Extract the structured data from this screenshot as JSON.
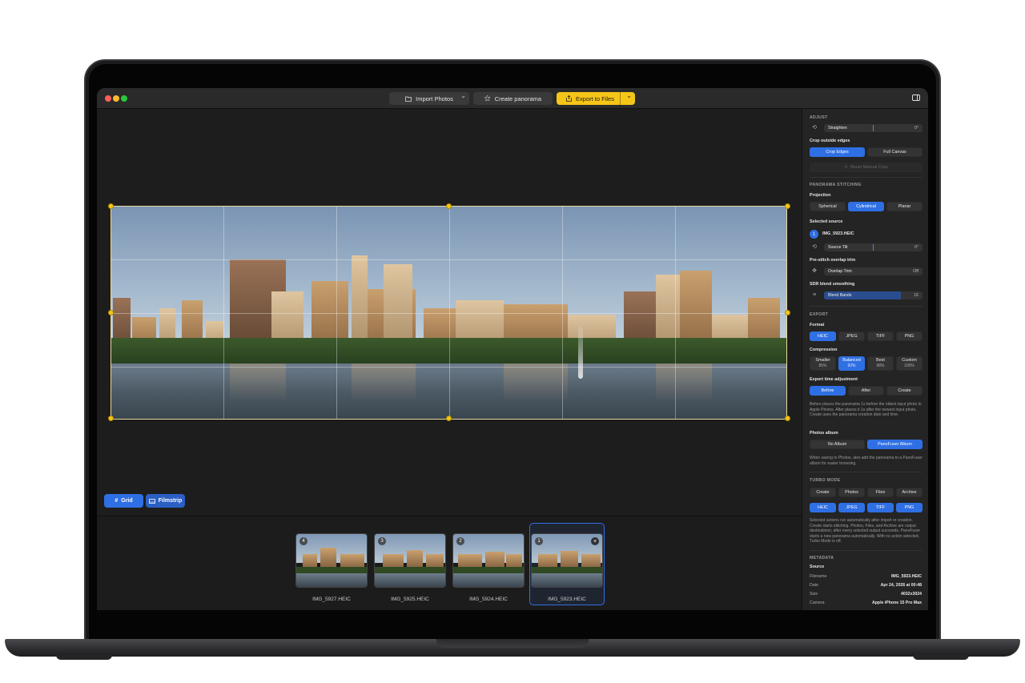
{
  "toolbar": {
    "import_label": "Import Photos",
    "create_label": "Create panorama",
    "export_label": "Export to Files"
  },
  "canvas_buttons": {
    "grid_label": "Grid",
    "filmstrip_label": "Filmstrip"
  },
  "filmstrip": {
    "items": [
      {
        "num": "4",
        "name": "IMG_5927.HEIC"
      },
      {
        "num": "3",
        "name": "IMG_5925.HEIC"
      },
      {
        "num": "2",
        "name": "IMG_5924.HEIC"
      },
      {
        "num": "1",
        "name": "IMG_5923.HEIC",
        "selected": true
      }
    ]
  },
  "inspector": {
    "adjust": {
      "header": "ADJUST",
      "straighten_label": "Straighten",
      "straighten_value": "0°",
      "crop_label": "Crop outside edges",
      "crop_options": [
        "Crop Edges",
        "Full Canvas"
      ],
      "crop_selected": "Crop Edges",
      "reset_label": "Reset Manual Crop"
    },
    "stitching": {
      "header": "PANORAMA STITCHING",
      "projection_label": "Projection",
      "projection_options": [
        "Spherical",
        "Cylindrical",
        "Planar"
      ],
      "projection_selected": "Cylindrical",
      "selected_source_label": "Selected source",
      "source_num": "1",
      "source_name": "IMG_5923.HEIC",
      "tilt_label": "Source Tilt",
      "tilt_value": "0°",
      "overlap_section": "Pre-stitch overlap trim",
      "overlap_label": "Overlap Trim",
      "overlap_value": "Off",
      "sdr_section": "SDR blend smoothing",
      "blend_label": "Blend Bands",
      "blend_value": "16",
      "blend_fraction": 0.78
    },
    "export": {
      "header": "EXPORT",
      "format_label": "Format",
      "formats": [
        "HEIC",
        "JPEG",
        "TIFF",
        "PNG"
      ],
      "format_selected": "HEIC",
      "compression_label": "Compression",
      "compression": [
        {
          "name": "Smaller",
          "value": "85%"
        },
        {
          "name": "Balanced",
          "value": "92%"
        },
        {
          "name": "Best",
          "value": "98%"
        },
        {
          "name": "Custom",
          "value": "100%"
        }
      ],
      "compression_selected": "Balanced",
      "time_label": "Export time adjustment",
      "time_options": [
        "Before",
        "After",
        "Create"
      ],
      "time_selected": "Before",
      "time_note": "Before places the panorama 1s before the oldest input photo in Apple Photos. After places it 1s after the newest input photo. Create uses the panorama creation date and time.",
      "album_label": "Photos album",
      "album_options": [
        "No Album",
        "PanoFuser Album"
      ],
      "album_selected": "PanoFuser Album",
      "album_note": "When saving to Photos, also add the panorama to a PanoFuser album for easier browsing."
    },
    "turbo": {
      "header": "TURBO MODE",
      "actions": [
        "Create",
        "Photos",
        "Files",
        "Archive"
      ],
      "formats": [
        "HEIC",
        "JPEG",
        "TIFF",
        "PNG"
      ],
      "note": "Selected actions run automatically after import or creation. Create starts stitching. Photos, Files, and Archive are output destinations; after every selected output succeeds, PanoFuser starts a new panorama automatically. With no action selected, Turbo Mode is off."
    },
    "metadata": {
      "header": "METADATA",
      "source_label": "Source",
      "rows": [
        {
          "key": "Filename",
          "value": "IMG_5923.HEIC"
        },
        {
          "key": "Date",
          "value": "Apr 24, 2026 at 00:48"
        },
        {
          "key": "Size",
          "value": "4032x3024"
        },
        {
          "key": "Camera",
          "value": "Apple iPhone 15 Pro Max"
        }
      ]
    }
  },
  "colors": {
    "accent": "#2f6fe4",
    "export_button": "#f5c518",
    "handle": "#f5c518"
  }
}
